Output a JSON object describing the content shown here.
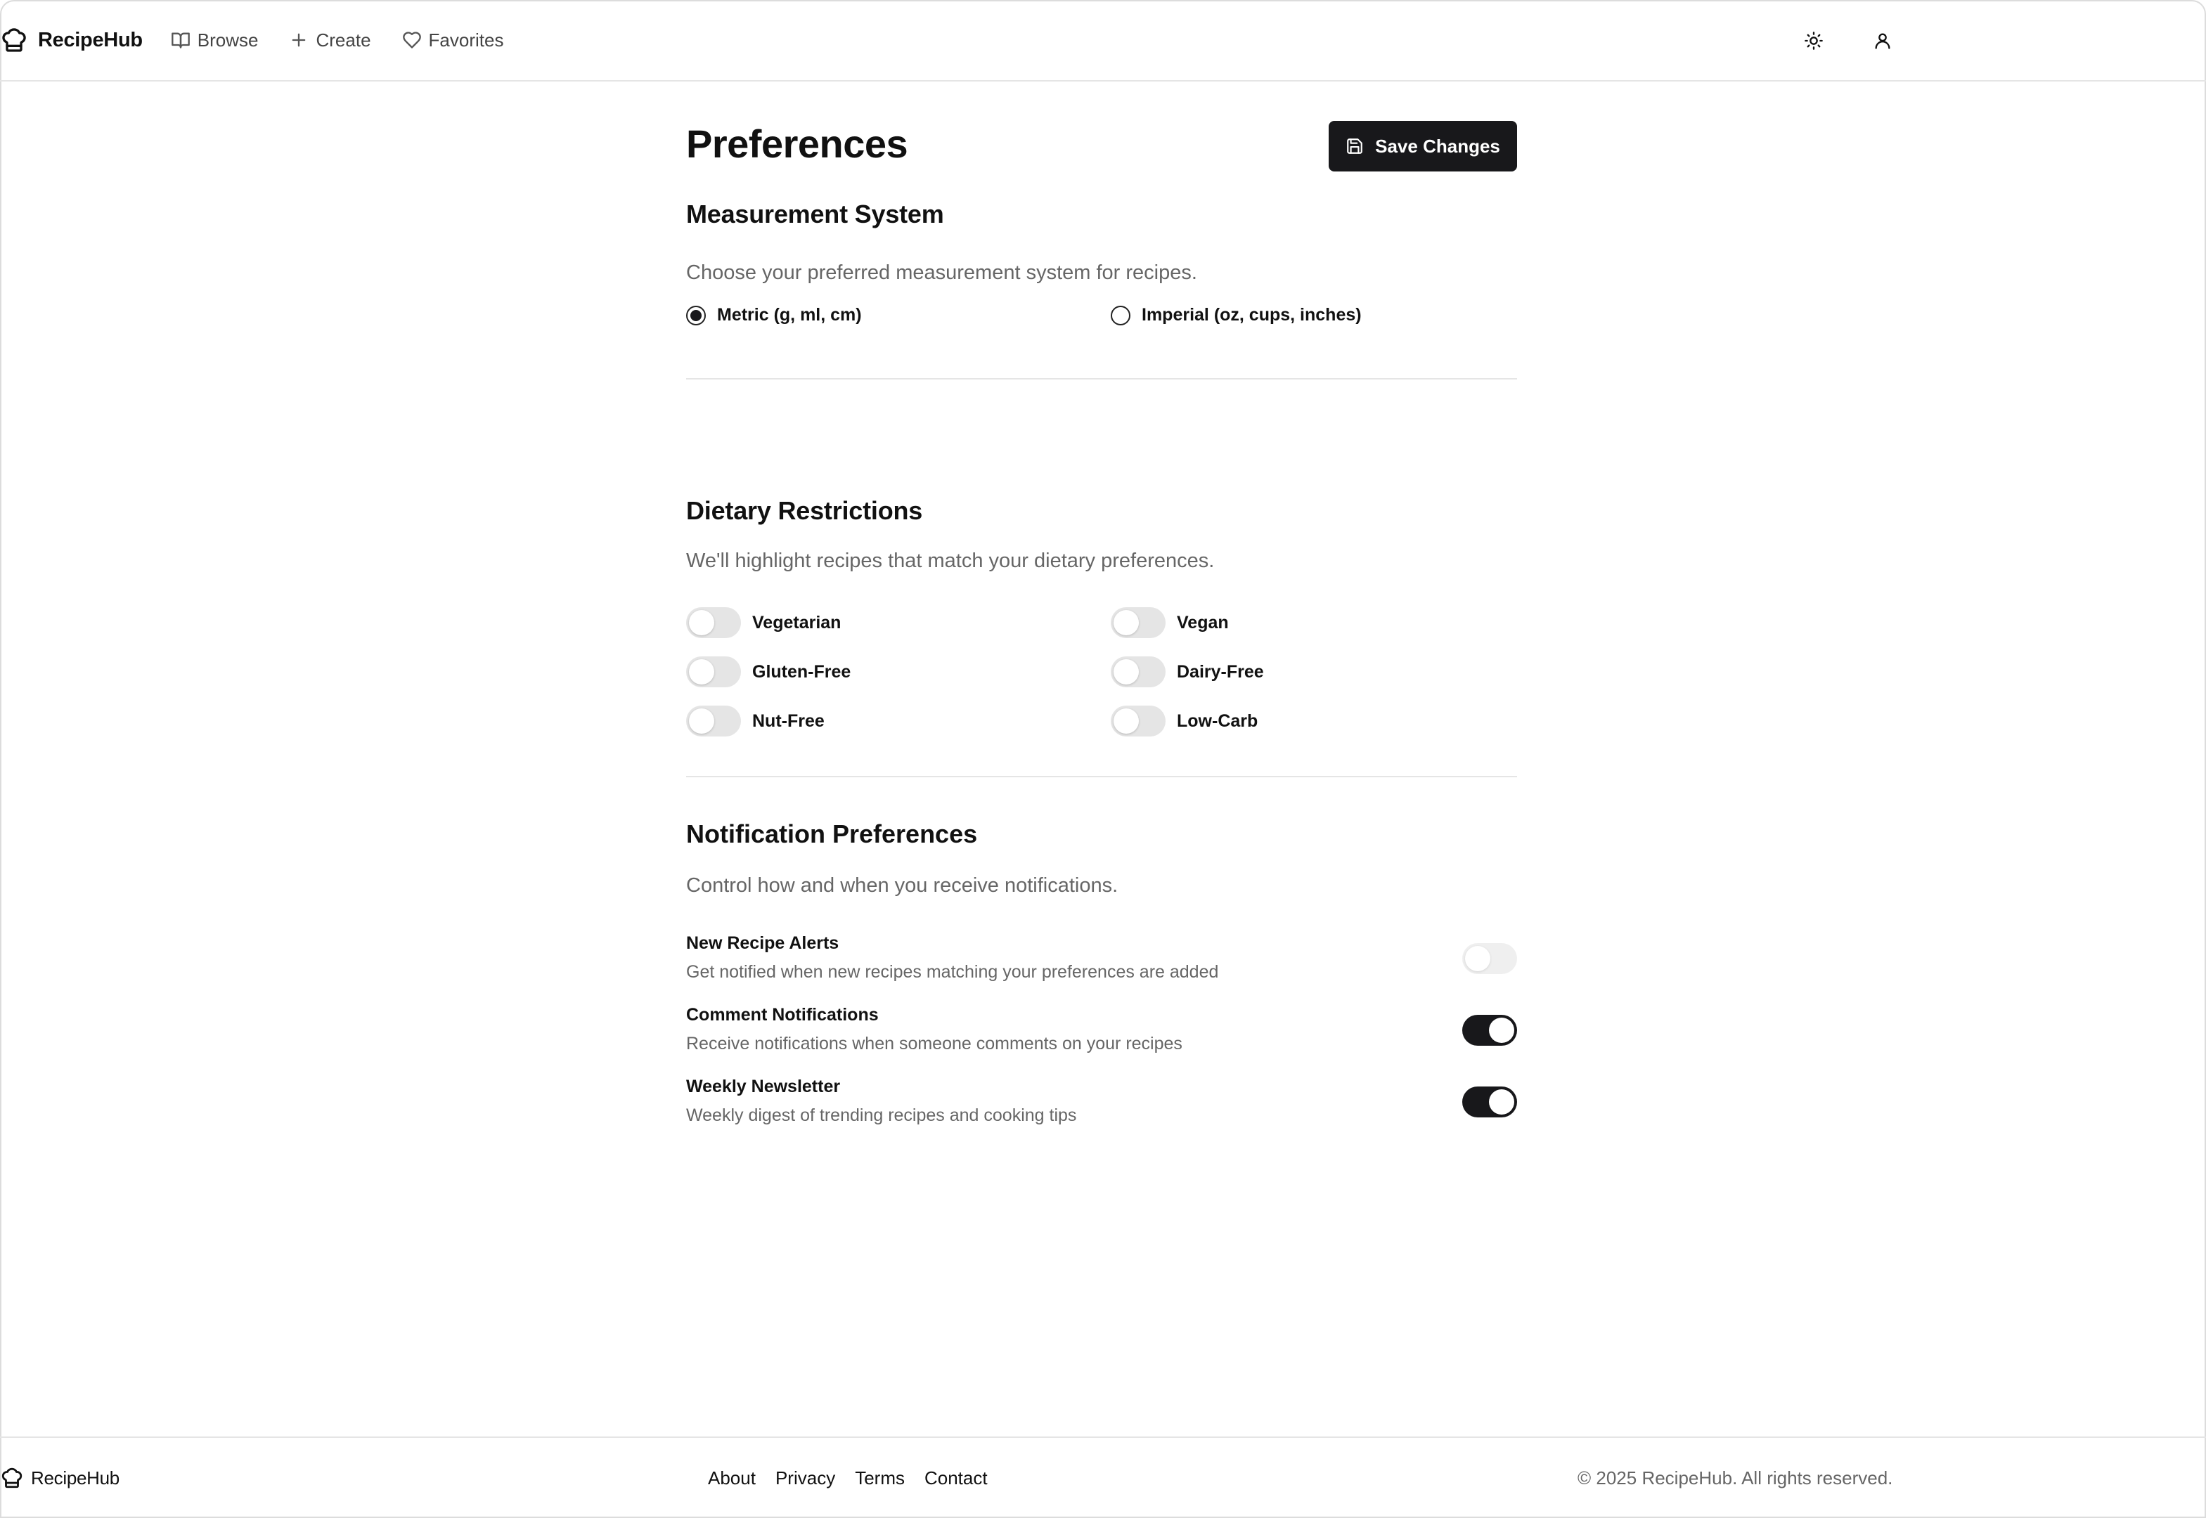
{
  "header": {
    "brand": "RecipeHub",
    "nav": [
      {
        "label": "Browse",
        "icon": "book-icon"
      },
      {
        "label": "Create",
        "icon": "plus-icon"
      },
      {
        "label": "Favorites",
        "icon": "heart-icon"
      }
    ],
    "actions": [
      {
        "icon": "sun-icon"
      },
      {
        "icon": "user-icon"
      }
    ]
  },
  "page": {
    "title": "Preferences",
    "save_label": "Save Changes"
  },
  "measurement": {
    "title": "Measurement System",
    "description": "Choose your preferred measurement system for recipes.",
    "options": [
      {
        "label": "Metric (g, ml, cm)",
        "selected": true
      },
      {
        "label": "Imperial (oz, cups, inches)",
        "selected": false
      }
    ]
  },
  "dietary": {
    "title": "Dietary Restrictions",
    "description": "We'll highlight recipes that match your dietary preferences.",
    "items": [
      {
        "label": "Vegetarian",
        "on": false
      },
      {
        "label": "Vegan",
        "on": false
      },
      {
        "label": "Gluten-Free",
        "on": false
      },
      {
        "label": "Dairy-Free",
        "on": false
      },
      {
        "label": "Nut-Free",
        "on": false
      },
      {
        "label": "Low-Carb",
        "on": false
      }
    ]
  },
  "notifications": {
    "title": "Notification Preferences",
    "description": "Control how and when you receive notifications.",
    "items": [
      {
        "title": "New Recipe Alerts",
        "subtitle": "Get notified when new recipes matching your preferences are added",
        "on": false
      },
      {
        "title": "Comment Notifications",
        "subtitle": "Receive notifications when someone comments on your recipes",
        "on": true
      },
      {
        "title": "Weekly Newsletter",
        "subtitle": "Weekly digest of trending recipes and cooking tips",
        "on": true
      }
    ]
  },
  "footer": {
    "brand": "RecipeHub",
    "links": [
      "About",
      "Privacy",
      "Terms",
      "Contact"
    ],
    "copyright": "© 2025 RecipeHub. All rights reserved."
  },
  "colors": {
    "primary": "#18181b",
    "toggle_off": "#e5e5e5",
    "muted_text": "#666666"
  }
}
